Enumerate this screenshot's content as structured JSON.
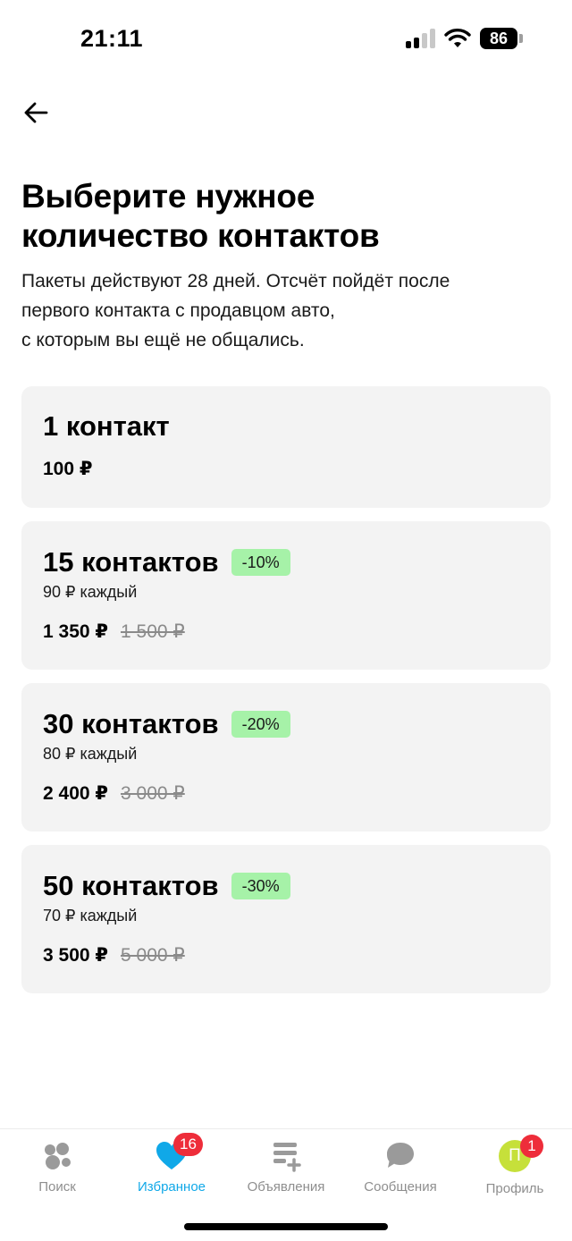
{
  "status_bar": {
    "time": "21:11",
    "battery": "86"
  },
  "header": {
    "title_lines": [
      "Выберите нужное",
      "количество контактов"
    ],
    "subtitle_lines": [
      "Пакеты действуют 28 дней. Отсчёт пойдёт после",
      "первого контакта с продавцом авто,",
      "с которым вы ещё не общались."
    ]
  },
  "packages": [
    {
      "title": "1 контакт",
      "price": "100 ₽"
    },
    {
      "title": "15 контактов",
      "discount": "-10%",
      "per_contact": "90 ₽ каждый",
      "price": "1 350 ₽",
      "old_price": "1 500 ₽"
    },
    {
      "title": "30 контактов",
      "discount": "-20%",
      "per_contact": "80 ₽ каждый",
      "price": "2 400 ₽",
      "old_price": "3 000 ₽"
    },
    {
      "title": "50 контактов",
      "discount": "-30%",
      "per_contact": "70 ₽ каждый",
      "price": "3 500 ₽",
      "old_price": "5 000 ₽"
    }
  ],
  "tab_bar": {
    "tabs": [
      {
        "label": "Поиск",
        "icon": "search-bubbles-icon"
      },
      {
        "label": "Избранное",
        "icon": "heart-icon",
        "badge": "16",
        "active": true
      },
      {
        "label": "Объявления",
        "icon": "listings-add-icon"
      },
      {
        "label": "Сообщения",
        "icon": "chat-bubble-icon"
      },
      {
        "label": "Профиль",
        "icon": "avatar",
        "avatar_letter": "П",
        "badge": "1"
      }
    ]
  },
  "colors": {
    "accent": "#10a8e8",
    "badge": "#ee2d3a",
    "discount_bg": "#a6f2a8",
    "card_bg": "#f3f3f3",
    "avatar_bg": "#c6e03a",
    "inactive": "#8e8e8e"
  }
}
